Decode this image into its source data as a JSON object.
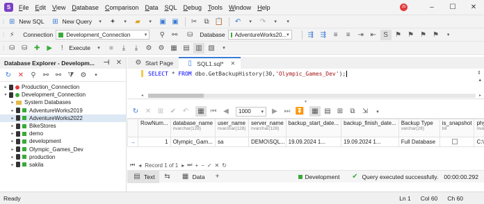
{
  "menu": [
    "File",
    "Edit",
    "View",
    "Database",
    "Comparison",
    "Data",
    "SQL",
    "Debug",
    "Tools",
    "Window",
    "Help"
  ],
  "user_initials": "JS",
  "toolbar1": {
    "new_sql": "New SQL",
    "new_query": "New Query"
  },
  "toolbar2": {
    "connection_label": "Connection",
    "connection_value": "Development_Connection",
    "database_label": "Database",
    "database_value": "AdventureWorks20..."
  },
  "toolbar3": {
    "execute": "Execute"
  },
  "explorer": {
    "title": "Database Explorer - Developm...",
    "tree": [
      {
        "label": "Production_Connection",
        "level": 0,
        "kind": "conn-red",
        "expanded": false
      },
      {
        "label": "Development_Connection",
        "level": 0,
        "kind": "conn-green",
        "expanded": true
      },
      {
        "label": "System Databases",
        "level": 1,
        "kind": "folder",
        "expanded": false
      },
      {
        "label": "AdventureWorks2019",
        "level": 1,
        "kind": "db",
        "expanded": false
      },
      {
        "label": "AdventureWorks2022",
        "level": 1,
        "kind": "db",
        "expanded": false,
        "selected": true
      },
      {
        "label": "BikeStores",
        "level": 1,
        "kind": "db",
        "expanded": false
      },
      {
        "label": "demo",
        "level": 1,
        "kind": "db",
        "expanded": false
      },
      {
        "label": "development",
        "level": 1,
        "kind": "db",
        "expanded": false
      },
      {
        "label": "Olympic_Games_Dev",
        "level": 1,
        "kind": "db",
        "expanded": false
      },
      {
        "label": "production",
        "level": 1,
        "kind": "db",
        "expanded": false
      },
      {
        "label": "sakila",
        "level": 1,
        "kind": "db",
        "expanded": false
      }
    ]
  },
  "tabs": [
    {
      "label": "Start Page",
      "active": false
    },
    {
      "label": "SQL1.sql*",
      "active": true
    }
  ],
  "editor": {
    "kw1": "SELECT",
    "star": " * ",
    "kw2": "FROM",
    "fn": " dbo.GetBackupHistory(30,",
    "str": "'Olympic_Games_Dev'",
    "end": ");"
  },
  "grid": {
    "page_size": "1000",
    "columns": [
      {
        "name": "RowNum...",
        "type": ""
      },
      {
        "name": "database_name",
        "type": "nvarchar(128)"
      },
      {
        "name": "user_name",
        "type": "nvarchar(128)"
      },
      {
        "name": "server_name",
        "type": "nvarchar(128)"
      },
      {
        "name": "backup_start_date...",
        "type": ""
      },
      {
        "name": "backup_finish_date...",
        "type": ""
      },
      {
        "name": "Backup Type",
        "type": "varchar(28)"
      },
      {
        "name": "is_snapshot",
        "type": "bit"
      },
      {
        "name": "physical_device_n",
        "type": "nvarchar(260)"
      }
    ],
    "rows": [
      [
        "1",
        "Olympic_Gam...",
        "sa",
        "DEMO\\SQL...",
        "19.09.2024 1...",
        "19.09.2024 1...",
        "Full Database",
        "",
        "C:\\Program Files\\"
      ]
    ],
    "record": "Record 1 of 1"
  },
  "bottom": {
    "text_tab": "Text",
    "data_tab": "Data",
    "connection": "Development",
    "status": "Query executed successfully.",
    "elapsed": "00:00:00.292"
  },
  "statusbar": {
    "left": "Ready",
    "ln": "Ln 1",
    "col": "Col 60",
    "ch": "Ch 60"
  },
  "colors": {
    "accent": "#3a7bd5",
    "green": "#3aa93a",
    "red": "#e23c3c",
    "brand": "#7b3fc2"
  }
}
